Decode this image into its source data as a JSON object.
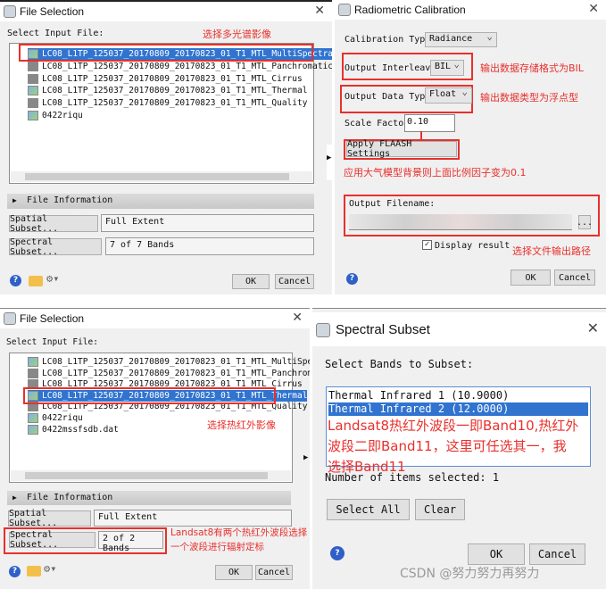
{
  "file_selection_1": {
    "title": "File Selection",
    "label": "Select Input File:",
    "files": [
      "LC08_L1TP_125037_20170809_20170823_01_T1_MTL_MultiSpectral",
      "LC08_L1TP_125037_20170809_20170823_01_T1_MTL_Panchromatic",
      "LC08_L1TP_125037_20170809_20170823_01_T1_MTL_Cirrus",
      "LC08_L1TP_125037_20170809_20170823_01_T1_MTL_Thermal",
      "LC08_L1TP_125037_20170809_20170823_01_T1_MTL_Quality",
      "0422riqu"
    ],
    "selected_index": 0,
    "file_info": "File Information",
    "spatial_btn": "Spatial Subset...",
    "spatial_val": "Full Extent",
    "spectral_btn": "Spectral Subset...",
    "spectral_val": "7 of 7 Bands",
    "ok": "OK",
    "cancel": "Cancel",
    "annotation": "选择多光谱影像"
  },
  "radiometric": {
    "title": "Radiometric Calibration",
    "calib_label": "Calibration Type",
    "calib_val": "Radiance",
    "interleave_label": "Output Interleave",
    "interleave_val": "BIL",
    "dtype_label": "Output Data Type",
    "dtype_val": "Float",
    "scale_label": "Scale Factor",
    "scale_val": "0.10",
    "flaash_btn": "Apply FLAASH Settings",
    "outfile_label": "Output Filename:",
    "browse": "...",
    "display_result": "Display result",
    "display_checked": true,
    "ok": "OK",
    "cancel": "Cancel",
    "ann_interleave": "输出数据存储格式为BIL",
    "ann_dtype": "输出数据类型为浮点型",
    "ann_flaash": "应用大气模型背景则上面比例因子变为0.1",
    "ann_output": "选择文件输出路径"
  },
  "file_selection_2": {
    "title": "File Selection",
    "label": "Select Input File:",
    "files": [
      "LC08_L1TP_125037_20170809_20170823_01_T1_MTL_MultiSpectral",
      "LC08_L1TP_125037_20170809_20170823_01_T1_MTL_Panchromatic",
      "LC08_L1TP_125037_20170809_20170823_01_T1_MTL_Cirrus",
      "LC08_L1TP_125037_20170809_20170823_01_T1_MTL_Thermal",
      "LC08_L1TP_125037_20170809_20170823_01_T1_MTL_Quality",
      "0422riqu",
      "0422mssfsdb.dat"
    ],
    "selected_index": 3,
    "file_info": "File Information",
    "spatial_btn": "Spatial Subset...",
    "spatial_val": "Full Extent",
    "spectral_btn": "Spectral Subset...",
    "spectral_val": "2 of 2 Bands",
    "ok": "OK",
    "cancel": "Cancel",
    "annotation": "选择热红外影像",
    "ann_spectral_1": "Landsat8有两个热红外波段选择",
    "ann_spectral_2": "一个波段进行辐射定标"
  },
  "spectral_subset": {
    "title": "Spectral Subset",
    "label": "Select Bands to Subset:",
    "bands": [
      "Thermal Infrared 1 (10.9000)",
      "Thermal Infrared 2 (12.0000)"
    ],
    "selected_index": 1,
    "count": "Number of items selected: 1",
    "select_all": "Select All",
    "clear": "Clear",
    "ok": "OK",
    "cancel": "Cancel",
    "annotation": [
      "Landsat8热红外波段一即Band10,热红外",
      "波段二即Band11，这里可任选其一，我",
      "选择Band11"
    ]
  },
  "watermark": "CSDN @努力努力再努力",
  "colors": {
    "annotation": "#e8302c",
    "selection": "#3074d0"
  }
}
